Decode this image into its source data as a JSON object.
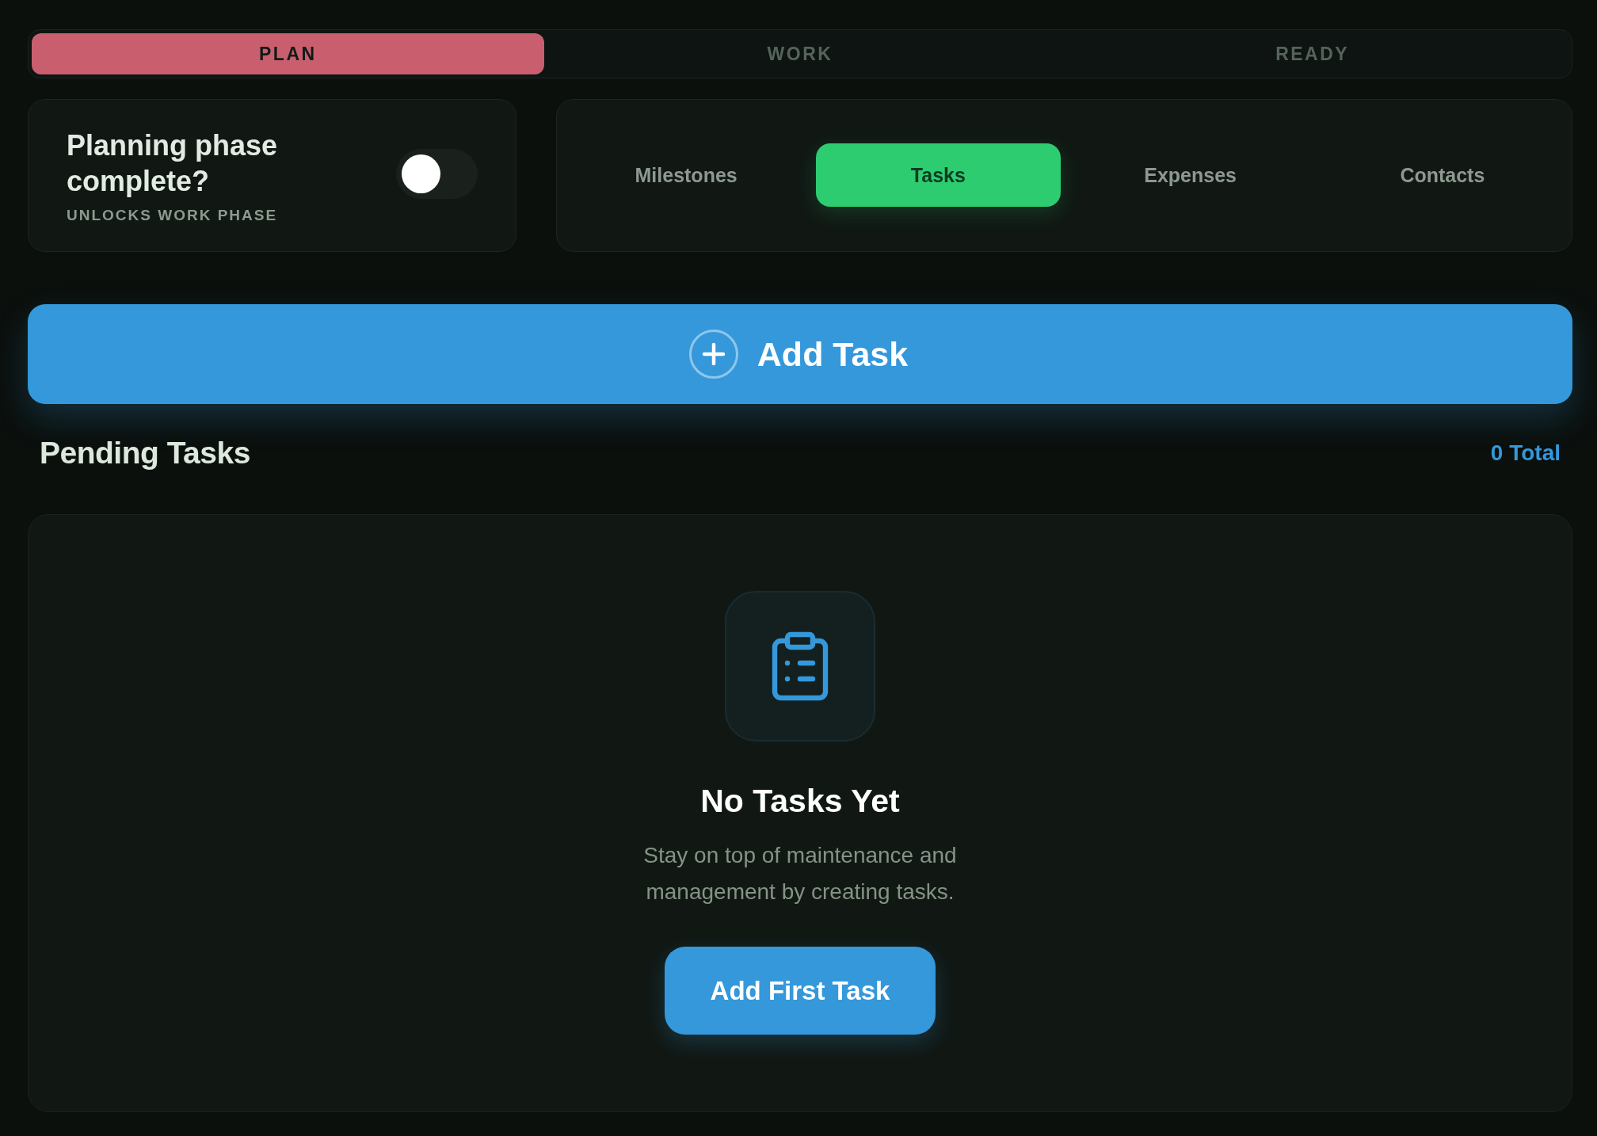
{
  "phase_tabs": [
    {
      "label": "PLAN",
      "selected": true
    },
    {
      "label": "WORK",
      "selected": false
    },
    {
      "label": "READY",
      "selected": false
    }
  ],
  "phase_toggle": {
    "title": "Planning phase complete?",
    "subtitle": "UNLOCKS WORK PHASE",
    "on": false
  },
  "section_tabs": [
    {
      "label": "Milestones",
      "selected": false
    },
    {
      "label": "Tasks",
      "selected": true
    },
    {
      "label": "Expenses",
      "selected": false
    },
    {
      "label": "Contacts",
      "selected": false
    }
  ],
  "add_button": {
    "label": "Add Task"
  },
  "list_header": {
    "title": "Pending Tasks",
    "count": "0 Total"
  },
  "empty_state": {
    "title": "No Tasks Yet",
    "message": "Stay on top of maintenance and management by creating tasks.",
    "button": "Add First Task"
  }
}
